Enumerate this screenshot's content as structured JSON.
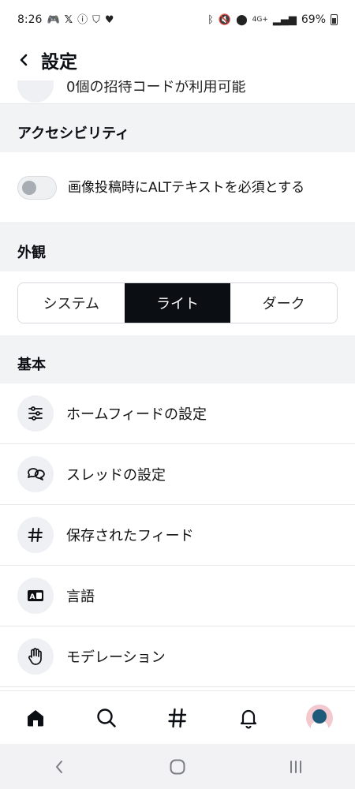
{
  "status_bar": {
    "time": "8:26",
    "battery": "69%",
    "network": "4G+"
  },
  "header": {
    "title": "設定",
    "back_icon": "chevron-left-icon"
  },
  "partial_row": {
    "text": "0個の招待コードが利用可能"
  },
  "sections": {
    "accessibility": {
      "title": "アクセシビリティ",
      "toggle_label": "画像投稿時にALTテキストを必須とする",
      "toggle_on": false
    },
    "appearance": {
      "title": "外観",
      "options": [
        "システム",
        "ライト",
        "ダーク"
      ],
      "selected": "ライト"
    },
    "basics": {
      "title": "基本",
      "items": [
        {
          "label": "ホームフィードの設定",
          "icon": "sliders-icon"
        },
        {
          "label": "スレッドの設定",
          "icon": "chat-bubbles-icon"
        },
        {
          "label": "保存されたフィード",
          "icon": "hash-icon"
        },
        {
          "label": "言語",
          "icon": "translate-icon"
        },
        {
          "label": "モデレーション",
          "icon": "hand-icon"
        }
      ]
    }
  },
  "bottom_nav": [
    "home-icon",
    "search-icon",
    "hash-icon",
    "bell-icon",
    "avatar"
  ],
  "system_nav": [
    "back-icon",
    "home-circle-icon",
    "recents-icon"
  ],
  "colors": {
    "accent_dark": "#0b0f14",
    "section_bg": "#f1f3f5",
    "icon_circle_bg": "#eef0f3"
  }
}
